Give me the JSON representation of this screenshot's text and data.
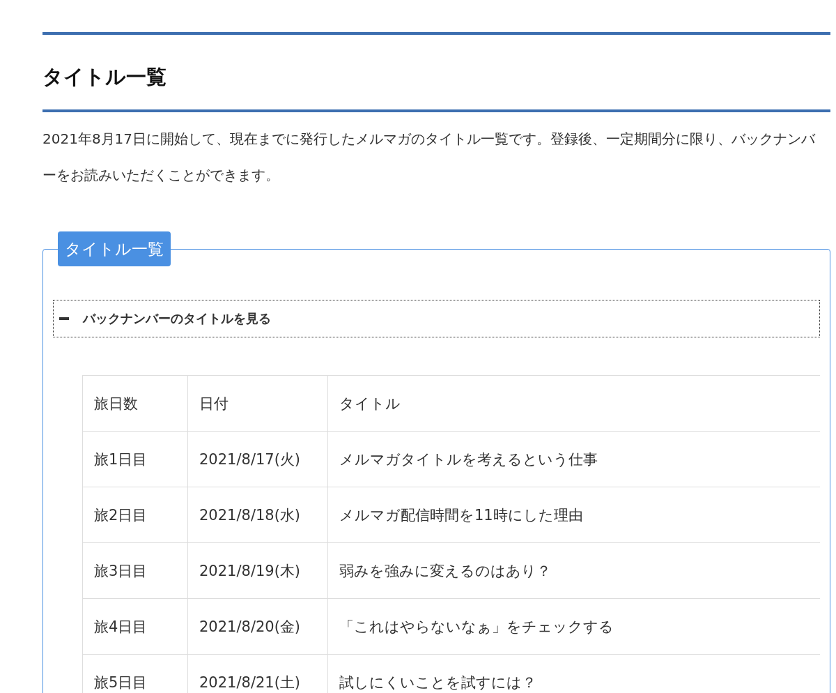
{
  "heading": "タイトル一覧",
  "intro": "2021年8月17日に開始して、現在までに発行したメルマガのタイトル一覧です。登録後、一定期間分に限り、バックナンバーをお読みいただくことができます。",
  "panel": {
    "legend": "タイトル一覧",
    "accordion": {
      "label": "バックナンバーのタイトルを見る",
      "expanded": true
    },
    "table": {
      "columns": [
        "旅日数",
        "日付",
        "タイトル"
      ],
      "rows": [
        [
          "旅1日目",
          "2021/8/17(火)",
          "メルマガタイトルを考えるという仕事"
        ],
        [
          "旅2日目",
          "2021/8/18(水)",
          "メルマガ配信時間を11時にした理由"
        ],
        [
          "旅3日目",
          "2021/8/19(木)",
          "弱みを強みに変えるのはあり？"
        ],
        [
          "旅4日目",
          "2021/8/20(金)",
          "「これはやらないなぁ」をチェックする"
        ],
        [
          "旅5日目",
          "2021/8/21(土)",
          "試しにくいことを試すには？"
        ]
      ]
    }
  }
}
